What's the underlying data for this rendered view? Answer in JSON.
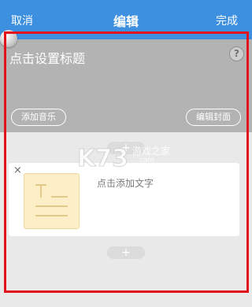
{
  "header": {
    "cancel_label": "取消",
    "title": "编辑",
    "done_label": "完成"
  },
  "cover": {
    "title_placeholder": "点击设置标题",
    "help_icon": "?",
    "add_music_label": "添加音乐",
    "edit_cover_label": "编辑封面"
  },
  "content": {
    "add_button_glyph": "+",
    "card": {
      "close_glyph": "×",
      "thumbnail_icon": "text-document-icon",
      "add_text_label": "点击添加文字"
    }
  },
  "watermark": {
    "logo": "K73",
    "site": "游戏之家",
    "domain": ".com"
  },
  "colors": {
    "header_bg": "#3d8fe0",
    "cover_bg": "#b3b3b3",
    "highlight_frame": "#e3121b",
    "thumbnail_bg": "#fcefc8"
  }
}
